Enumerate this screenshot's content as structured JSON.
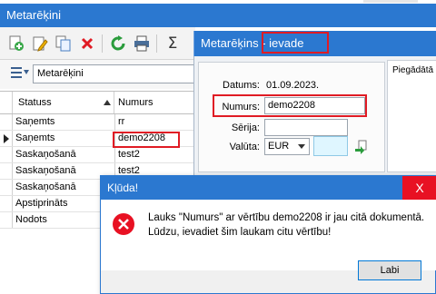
{
  "main_window": {
    "title": "Metarēķini",
    "toolbar": {
      "icons": [
        "add-icon",
        "edit-icon",
        "copy-icon",
        "delete-icon",
        "refresh-icon",
        "print-icon",
        "sum-icon"
      ]
    },
    "filter": {
      "value": "Metarēķini"
    },
    "grid": {
      "columns": [
        "Statuss",
        "Numurs"
      ],
      "rows": [
        {
          "status": "Saņemts",
          "number": "rr"
        },
        {
          "status": "Saņemts",
          "number": "demo2208"
        },
        {
          "status": "Saskaņošanā",
          "number": "test2"
        },
        {
          "status": "Saskaņošanā",
          "number": "test2"
        },
        {
          "status": "Saskaņošanā",
          "number": ""
        },
        {
          "status": "Apstiprināts",
          "number": ""
        },
        {
          "status": "Nodots",
          "number": ""
        }
      ]
    }
  },
  "invoice_window": {
    "title": "Metarēķins - ievade",
    "tab_label": "Piegādātā",
    "fields": {
      "date_label": "Datums:",
      "date_value": "01.09.2023.",
      "number_label": "Numurs:",
      "number_value": "demo2208",
      "series_label": "Sērija:",
      "series_value": "",
      "currency_label": "Valūta:",
      "currency_value": "EUR"
    }
  },
  "error_dialog": {
    "title": "Kļūda!",
    "close_label": "X",
    "message": "Lauks \"Numurs\" ar vērtību demo2208 ir jau citā dokumentā. Lūdzu, ievadiet šim laukam citu vērtību!",
    "ok_label": "Labi"
  },
  "colors": {
    "titlebar": "#2b78d0",
    "highlight": "#e01b24",
    "close": "#e81123",
    "error_icon": "#e81123"
  }
}
